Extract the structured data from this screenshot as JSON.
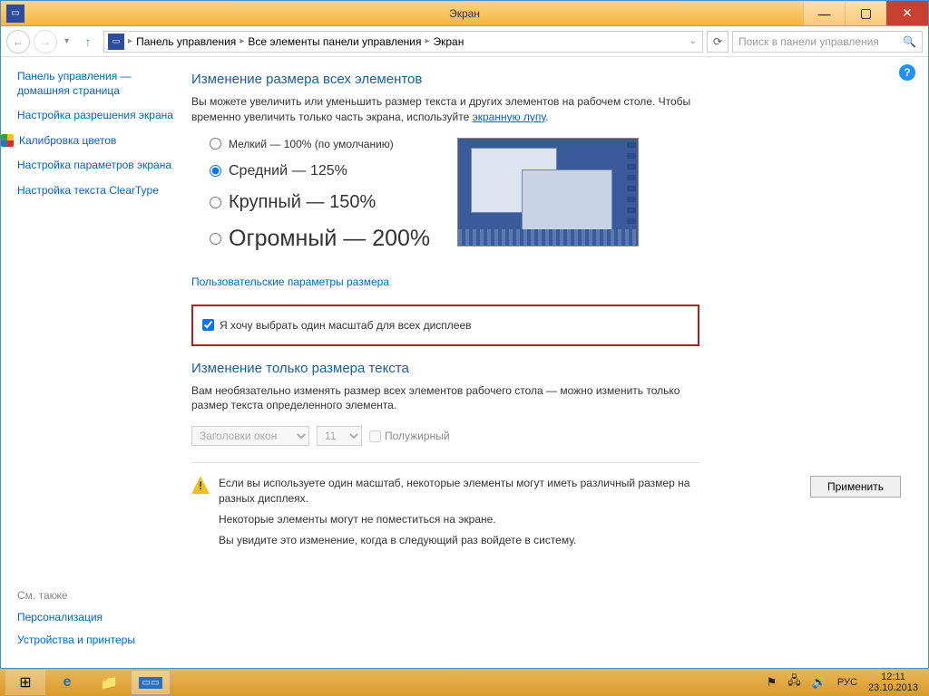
{
  "titlebar": {
    "title": "Экран"
  },
  "breadcrumb": {
    "items": [
      "Панель управления",
      "Все элементы панели управления",
      "Экран"
    ]
  },
  "search": {
    "placeholder": "Поиск в панели управления"
  },
  "sidebar": {
    "home": "Панель управления — домашняя страница",
    "links": [
      "Настройка разрешения экрана",
      "Калибровка цветов",
      "Настройка параметров экрана",
      "Настройка текста ClearType"
    ]
  },
  "seealso": {
    "header": "См. также",
    "links": [
      "Персонализация",
      "Устройства и принтеры"
    ]
  },
  "main": {
    "heading1": "Изменение размера всех элементов",
    "desc1a": "Вы можете увеличить или уменьшить размер текста и других элементов на рабочем столе. Чтобы временно увеличить только часть экрана, используйте ",
    "desc1link": "экранную лупу",
    "radios": {
      "small": "Мелкий — 100% (по умолчанию)",
      "medium": "Средний — 125%",
      "large": "Крупный — 150%",
      "huge": "Огромный — 200%"
    },
    "customlink": "Пользовательские параметры размера",
    "checkbox_all": "Я хочу выбрать один масштаб для всех дисплеев",
    "heading2": "Изменение только размера текста",
    "desc2": "Вам необязательно изменять размер всех элементов рабочего стола — можно изменить только размер текста определенного элемента.",
    "select_item": "Заголовки окон",
    "select_size": "11",
    "bold_label": "Полужирный",
    "warning": {
      "line1": "Если вы используете один масштаб, некоторые элементы могут иметь различный размер на разных дисплеях.",
      "line2": "Некоторые элементы могут не поместиться на экране.",
      "line3": "Вы увидите это изменение, когда в следующий раз войдете в систему."
    },
    "apply": "Применить"
  },
  "taskbar": {
    "lang": "РУС",
    "time": "12:11",
    "date": "23.10.2013"
  }
}
